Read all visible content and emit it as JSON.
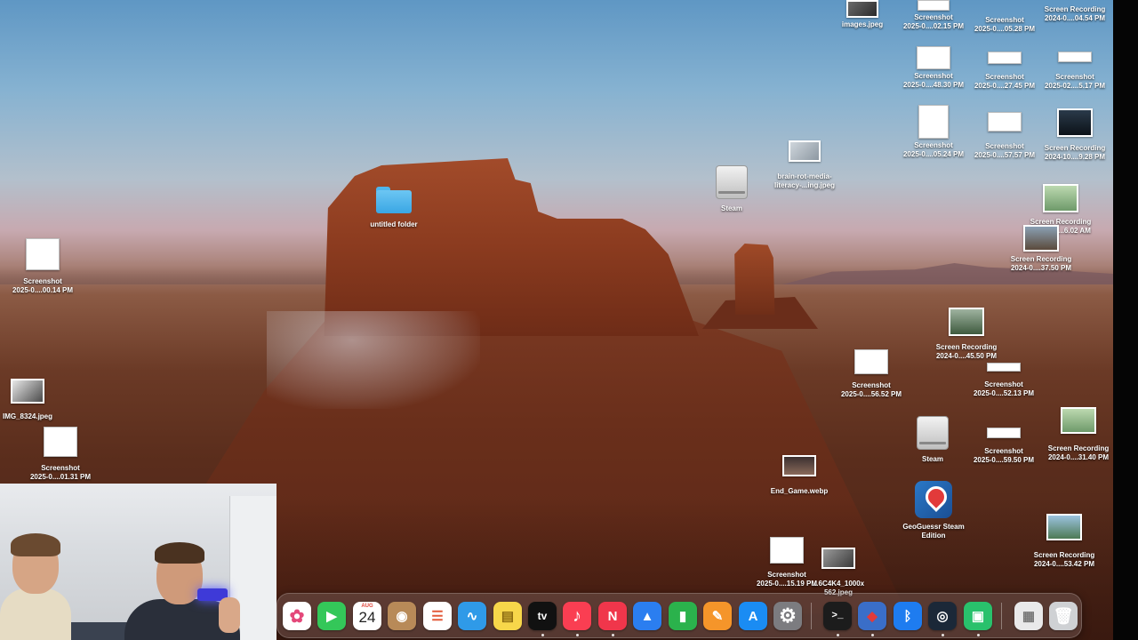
{
  "desktop": {
    "icons": [
      {
        "label1": "images.jpeg",
        "label2": ""
      },
      {
        "label1": "Screenshot",
        "label2": "2025-0....02.15 PM"
      },
      {
        "label1": "Screenshot",
        "label2": "2025-0....05.28 PM"
      },
      {
        "label1": "Screen Recording",
        "label2": "2024-0....04.54 PM"
      },
      {
        "label1": "Screenshot",
        "label2": "2025-0....48.30 PM"
      },
      {
        "label1": "Screenshot",
        "label2": "2025-0....27.45 PM"
      },
      {
        "label1": "Screenshot",
        "label2": "2025-02....5.17 PM"
      },
      {
        "label1": "Screenshot",
        "label2": "2025-0....05.24 PM"
      },
      {
        "label1": "Screenshot",
        "label2": "2025-0....57.57 PM"
      },
      {
        "label1": "Screen Recording",
        "label2": "2024-10....9.28 PM"
      },
      {
        "label1": "brain-rot-media-",
        "label2": "literacy-...ing.jpeg"
      },
      {
        "label1": "Steam",
        "label2": ""
      },
      {
        "label1": "untitled folder",
        "label2": ""
      },
      {
        "label1": "Screen Recording",
        "label2": "2024-11....6.02 AM"
      },
      {
        "label1": "Screen Recording",
        "label2": "2024-0....37.50 PM"
      },
      {
        "label1": "Screenshot",
        "label2": "2025-0....00.14 PM"
      },
      {
        "label1": "Screen Recording",
        "label2": "2024-0....45.50 PM"
      },
      {
        "label1": "Screenshot",
        "label2": "2025-0....56.52 PM"
      },
      {
        "label1": "Screenshot",
        "label2": "2025-0....52.13 PM"
      },
      {
        "label1": "IMG_8324.jpeg",
        "label2": ""
      },
      {
        "label1": "Screenshot",
        "label2": "2025-0....01.31 PM"
      },
      {
        "label1": "Steam",
        "label2": ""
      },
      {
        "label1": "Screen Recording",
        "label2": "2024-0....31.40 PM"
      },
      {
        "label1": "Screenshot",
        "label2": "2025-0....59.50 PM"
      },
      {
        "label1": "End_Game.webp",
        "label2": ""
      },
      {
        "label1": "GeoGuessr Steam",
        "label2": "Edition"
      },
      {
        "label1": "Screen Recording",
        "label2": "2024-0....53.42 PM"
      },
      {
        "label1": "Screenshot",
        "label2": "2025-0....15.19 PM"
      },
      {
        "label1": "...6C4K4_1000x",
        "label2": "562.jpeg"
      }
    ]
  },
  "dock": {
    "apps": [
      {
        "name": "Photos",
        "glyph": "✿",
        "color": "#ffffff"
      },
      {
        "name": "FaceTime",
        "glyph": "▶",
        "color": "#34c759"
      },
      {
        "name": "Calendar",
        "glyph": "",
        "color": "#ffffff"
      },
      {
        "name": "Contacts",
        "glyph": "◉",
        "color": "#b88a58"
      },
      {
        "name": "Reminders",
        "glyph": "☰",
        "color": "#ffffff"
      },
      {
        "name": "Freeform",
        "glyph": "∿",
        "color": "#2f9ae8"
      },
      {
        "name": "Notes",
        "glyph": "▤",
        "color": "#f7d74a"
      },
      {
        "name": "TV",
        "glyph": "tv",
        "color": "#111111"
      },
      {
        "name": "Music",
        "glyph": "♪",
        "color": "#fa3e52"
      },
      {
        "name": "News",
        "glyph": "N",
        "color": "#f0364b"
      },
      {
        "name": "Keynote",
        "glyph": "▲",
        "color": "#2b7ef0"
      },
      {
        "name": "Numbers",
        "glyph": "▮",
        "color": "#2bb24c"
      },
      {
        "name": "Pages",
        "glyph": "✎",
        "color": "#f5952a"
      },
      {
        "name": "App Store",
        "glyph": "A",
        "color": "#1a8cf3"
      },
      {
        "name": "System Settings",
        "glyph": "⚙",
        "color": "#7c7c80"
      },
      {
        "name": "Terminal",
        "glyph": ">_",
        "color": "#1c1c1c"
      },
      {
        "name": "GeoGuessr",
        "glyph": "◆",
        "color": "#3a6ec8"
      },
      {
        "name": "Bluetooth",
        "glyph": "ᛒ",
        "color": "#1e7cf0"
      },
      {
        "name": "Steam",
        "glyph": "◎",
        "color": "#1b2838"
      },
      {
        "name": "Android",
        "glyph": "▣",
        "color": "#29c16c"
      },
      {
        "name": "Downloads",
        "glyph": "▦",
        "color": "#e9e9ea"
      },
      {
        "name": "Trash",
        "glyph": "🗑",
        "color": "#cfd1d4"
      }
    ],
    "calendar_month": "AUG",
    "calendar_day": "24"
  }
}
